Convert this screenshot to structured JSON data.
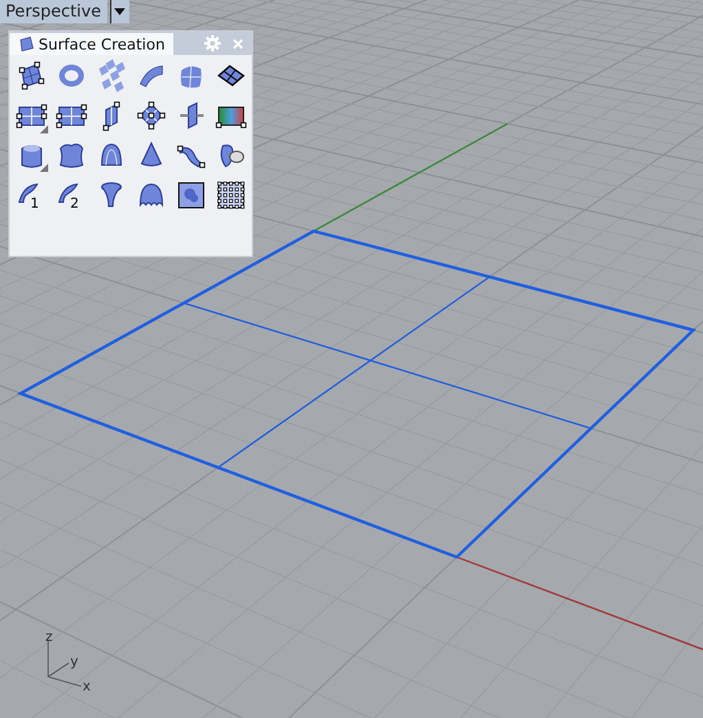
{
  "viewport": {
    "label": "Perspective",
    "axis_labels": {
      "z": "z",
      "y": "y",
      "x": "x"
    }
  },
  "panel": {
    "title": "Surface Creation",
    "tools": [
      {
        "kind": "handle-quad",
        "flyout": false
      },
      {
        "kind": "sphere",
        "flyout": false
      },
      {
        "kind": "scatter",
        "flyout": false
      },
      {
        "kind": "curved",
        "flyout": false
      },
      {
        "kind": "patch",
        "flyout": false
      },
      {
        "kind": "diamond-frame",
        "flyout": false
      },
      {
        "kind": "pane-grid",
        "flyout": true
      },
      {
        "kind": "pane-grid",
        "flyout": false
      },
      {
        "kind": "vertical-plane",
        "flyout": false
      },
      {
        "kind": "diamond-handles",
        "flyout": false
      },
      {
        "kind": "cut-plane",
        "flyout": false
      },
      {
        "kind": "gradient",
        "flyout": false
      },
      {
        "kind": "block",
        "flyout": true
      },
      {
        "kind": "block-soft",
        "flyout": false
      },
      {
        "kind": "arch",
        "flyout": false
      },
      {
        "kind": "cone",
        "flyout": false
      },
      {
        "kind": "sweep",
        "flyout": false
      },
      {
        "kind": "blob-disc",
        "flyout": false
      },
      {
        "kind": "numbered-arch",
        "flyout": false,
        "number": "1"
      },
      {
        "kind": "numbered-arch",
        "flyout": false,
        "number": "2"
      },
      {
        "kind": "funnel",
        "flyout": false
      },
      {
        "kind": "ripple",
        "flyout": false
      },
      {
        "kind": "square-blob",
        "flyout": false
      },
      {
        "kind": "dotted-grid",
        "flyout": false
      }
    ]
  }
}
